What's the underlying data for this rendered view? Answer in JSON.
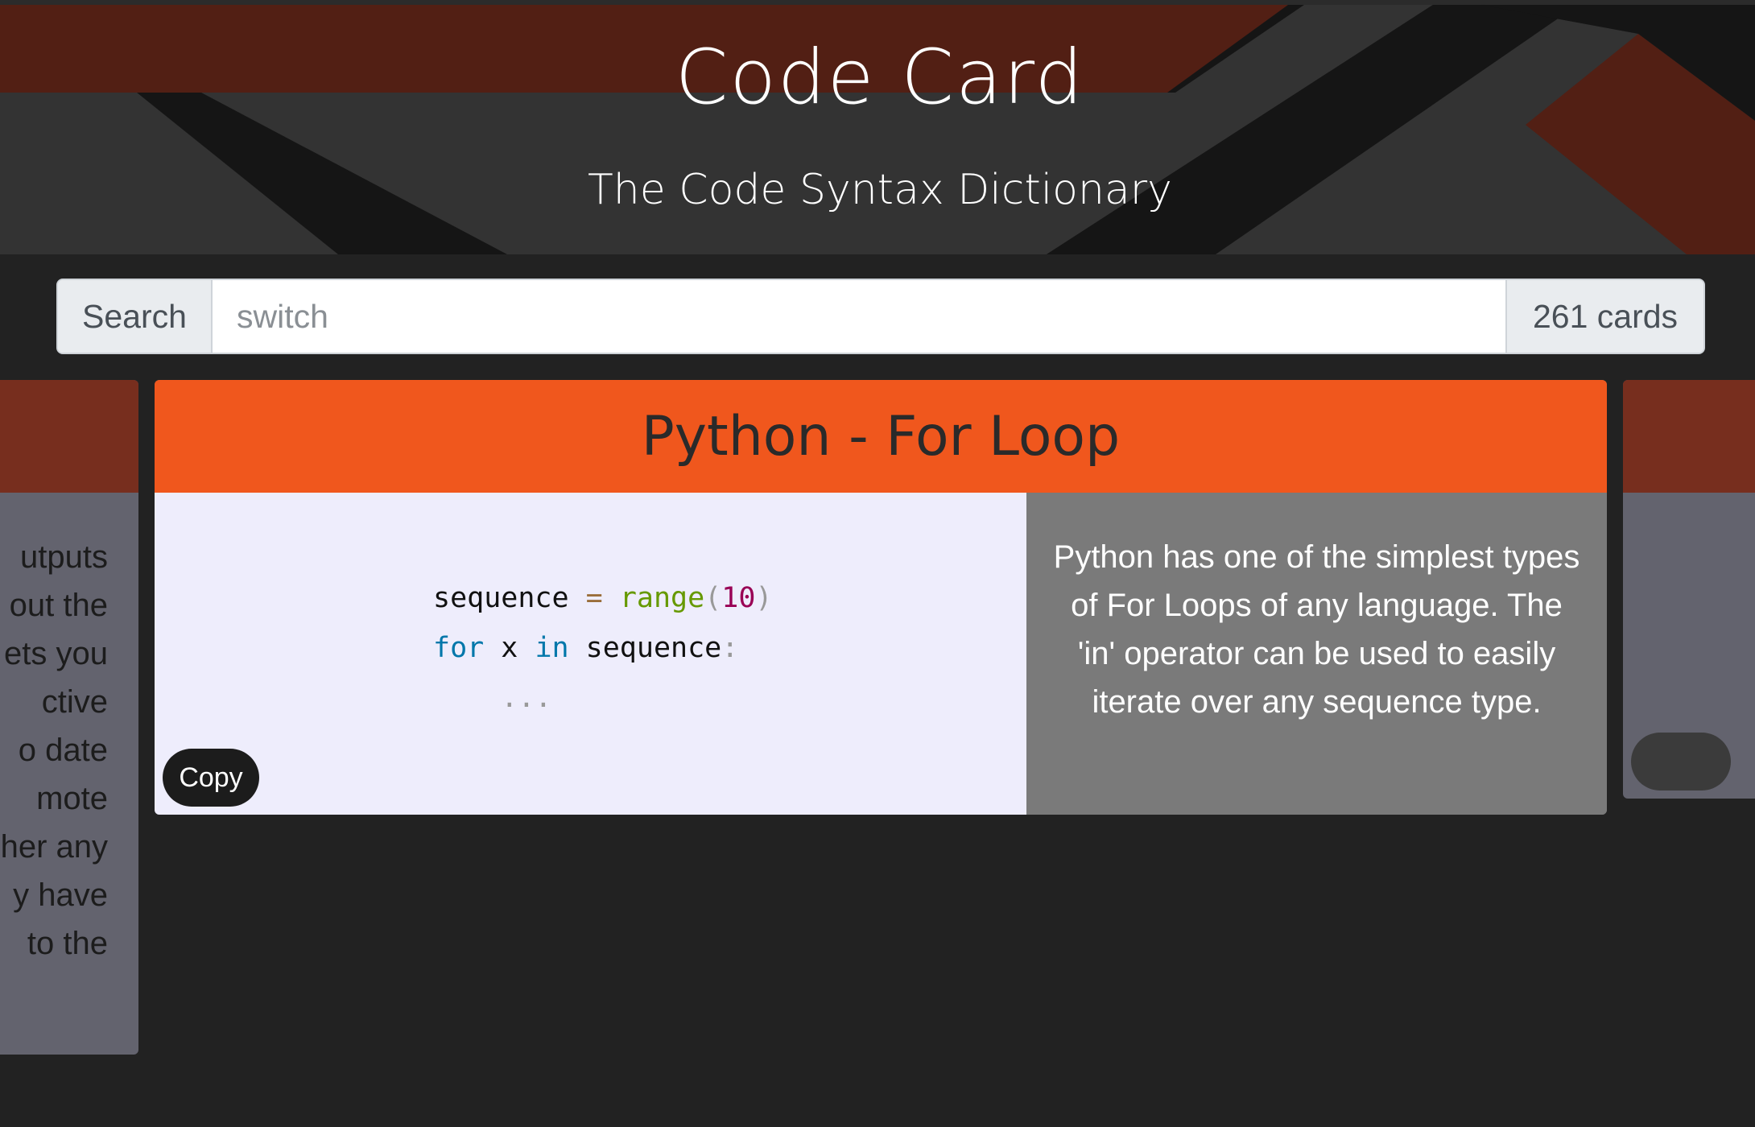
{
  "header": {
    "title": "Code Card",
    "subtitle": "The Code Syntax Dictionary"
  },
  "search": {
    "label": "Search",
    "placeholder": "switch",
    "value": "",
    "count_text": "261 cards"
  },
  "left_card": {
    "lines": [
      "utputs",
      "out the",
      "ets you",
      "ctive",
      "o date",
      "mote",
      "her any",
      "y have",
      "to the"
    ]
  },
  "card": {
    "title": "Python - For Loop",
    "code_line1_a": "sequence ",
    "code_line1_op": "=",
    "code_line1_fn": "range",
    "code_line1_p1": "(",
    "code_line1_num": "10",
    "code_line1_p2": ")",
    "code_line2_kw1": "for",
    "code_line2_var": " x ",
    "code_line2_kw2": "in",
    "code_line2_seq": " sequence",
    "code_line2_colon": ":",
    "code_line3": "    ...",
    "copy_label": "Copy",
    "description": "Python has one of the simplest types of For Loops of any language. The 'in' operator can be used to easily iterate over any sequence type."
  },
  "colors": {
    "accent": "#f0571d",
    "background": "#222222",
    "code_bg": "#eeedfc",
    "desc_bg": "#7a7a7a",
    "side_card_head": "#772e1e"
  }
}
